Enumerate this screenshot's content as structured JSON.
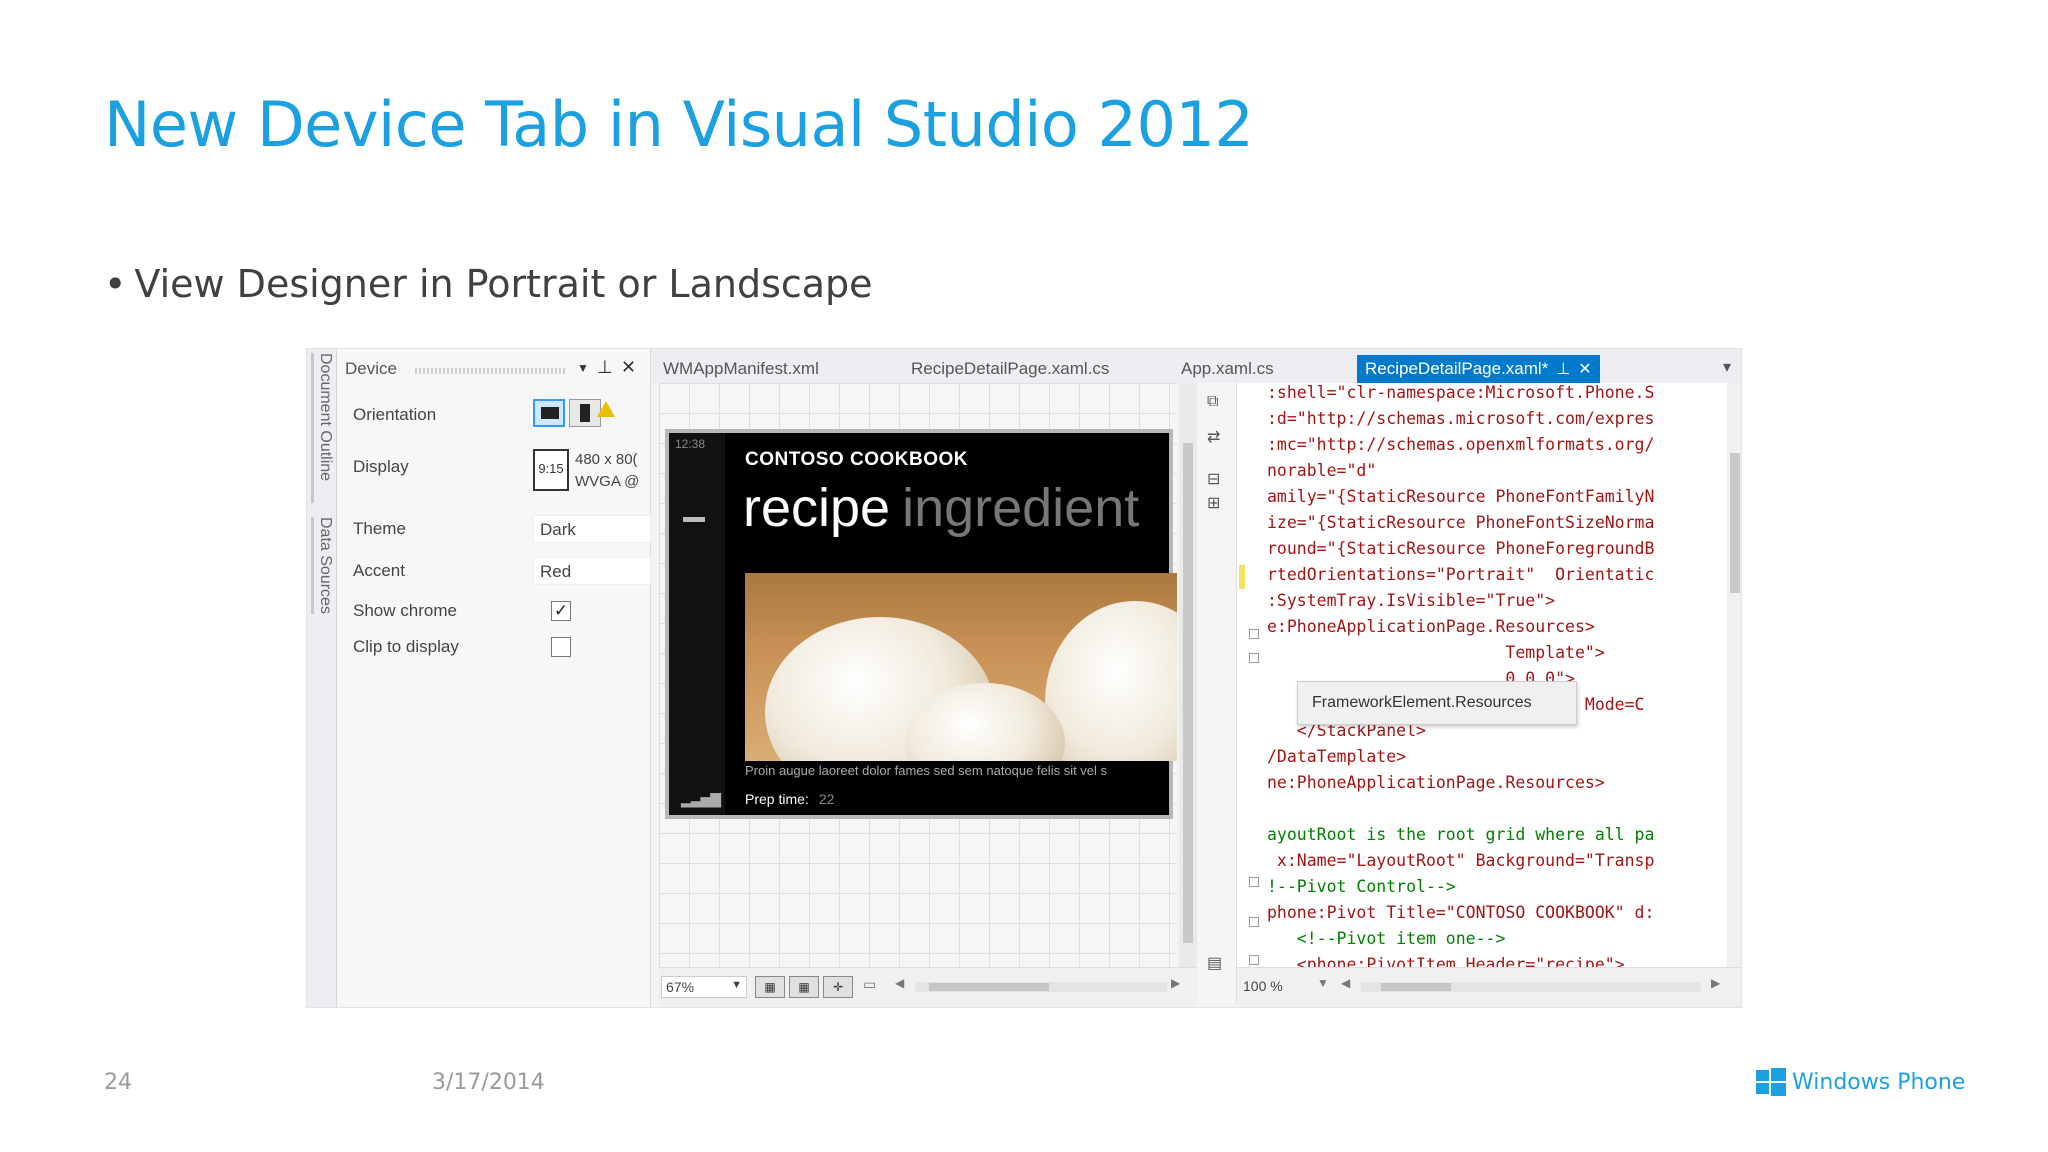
{
  "slide": {
    "title": "New Device Tab in Visual Studio 2012",
    "bullet": "View Designer in Portrait or Landscape",
    "page_number": "24",
    "date": "3/17/2014",
    "brand": "Windows Phone"
  },
  "ide": {
    "side_tabs": [
      "Document Outline",
      "Data Sources"
    ],
    "device_panel": {
      "title": "Device",
      "orientation_label": "Orientation",
      "display_label": "Display",
      "display_icon_text": "9:15",
      "display_res": "480 x 80(",
      "display_sub": "WVGA @",
      "theme_label": "Theme",
      "theme_value": "Dark",
      "accent_label": "Accent",
      "accent_value": "Red",
      "show_chrome_label": "Show chrome",
      "show_chrome_checked": true,
      "clip_label": "Clip to display",
      "clip_checked": false
    },
    "tabs": [
      {
        "label": "WMAppManifest.xml",
        "active": false
      },
      {
        "label": "RecipeDetailPage.xaml.cs",
        "active": false
      },
      {
        "label": "App.xaml.cs",
        "active": false
      },
      {
        "label": "RecipeDetailPage.xaml*",
        "active": true
      }
    ],
    "phone": {
      "clock": "12:38",
      "app_title": "CONTOSO COOKBOOK",
      "pivot_active": "recipe",
      "pivot_next": "ingredient",
      "caption": "Proin augue laoreet dolor fames sed sem natoque felis sit vel s",
      "prep_label": "Prep time:",
      "prep_value": "22"
    },
    "designer_zoom": "67%",
    "code_zoom": "100 %",
    "tooltip": "FrameworkElement.Resources",
    "code_lines": [
      ":shell=\"clr-namespace:Microsoft.Phone.S",
      ":d=\"http://schemas.microsoft.com/expres",
      ":mc=\"http://schemas.openxmlformats.org/",
      "norable=\"d\"",
      "amily=\"{StaticResource PhoneFontFamilyN",
      "ize=\"{StaticResource PhoneFontSizeNorma",
      "round=\"{StaticResource PhoneForegroundB",
      "rtedOrientations=\"Portrait\"  Orientatic",
      ":SystemTray.IsVisible=\"True\">",
      "e:PhoneApplicationPage.Resources>",
      "                        Template\">",
      "                        0,0,0\">",
      "      <TextBlock Text=\"{Binding Mode=C",
      "   </StackPanel>",
      "/DataTemplate>",
      "ne:PhoneApplicationPage.Resources>",
      "",
      "ayoutRoot is the root grid where all pa",
      " x:Name=\"LayoutRoot\" Background=\"Transp",
      "!--Pivot Control-->",
      "phone:Pivot Title=\"CONTOSO COOKBOOK\" d:",
      "   <!--Pivot item one-->",
      "   <phone:PivotItem Header=\"recipe\">"
    ]
  },
  "colors": {
    "accent": "#1ba1e2",
    "active_tab": "#007acc"
  },
  "icons": {
    "pin": "pin-icon",
    "close": "close-icon",
    "dropdown": "chevron-down-icon",
    "warning": "warning-icon",
    "windows_logo": "windows-logo-icon"
  }
}
